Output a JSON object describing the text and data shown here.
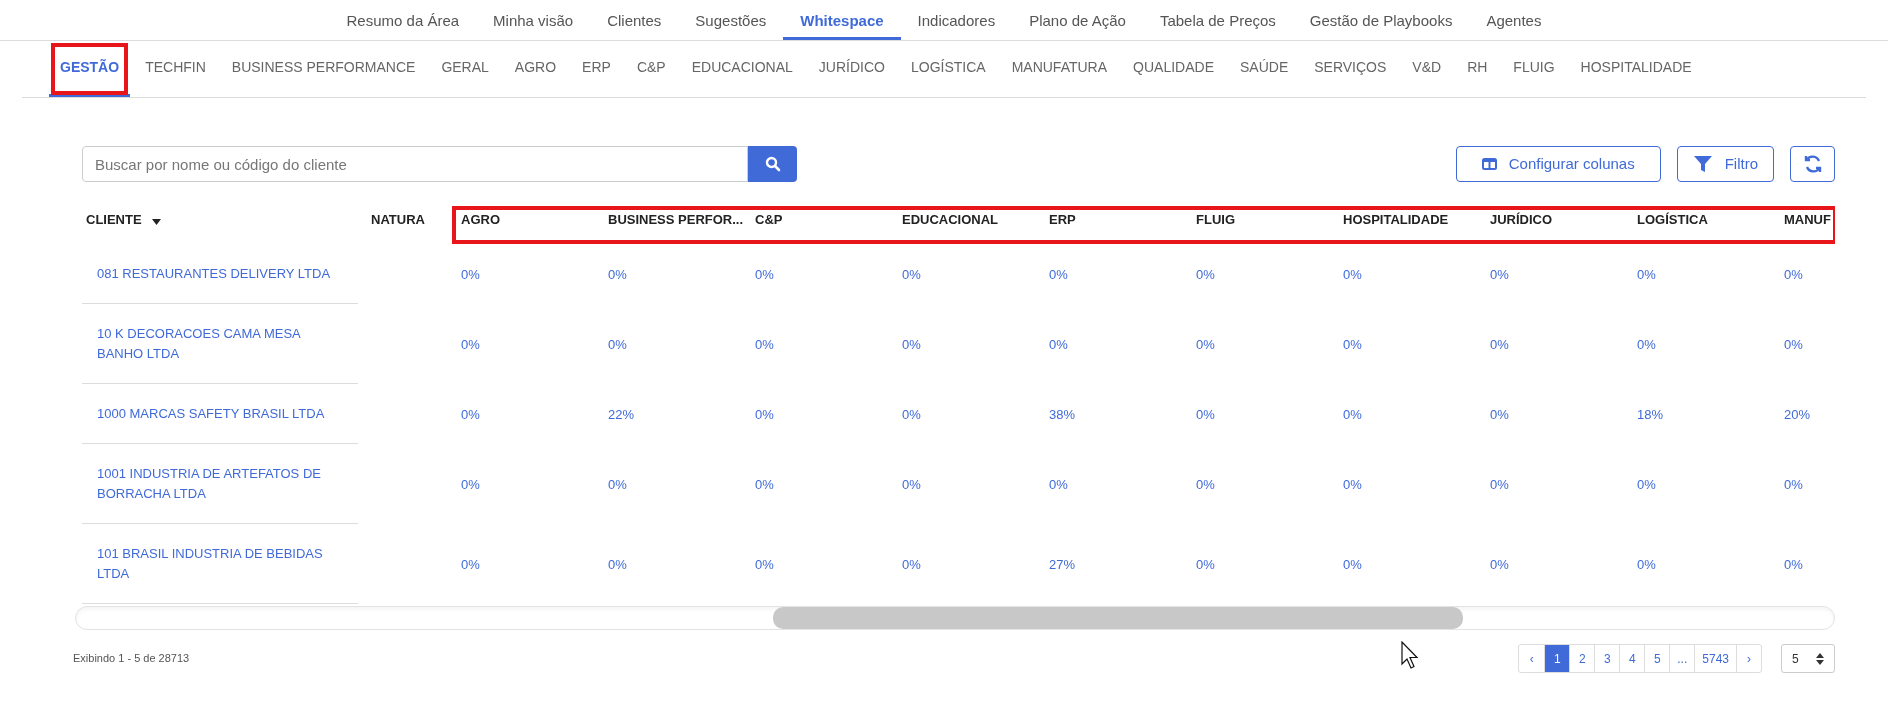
{
  "top_nav": [
    {
      "label": "Resumo da Área",
      "selected": false
    },
    {
      "label": "Minha visão",
      "selected": false
    },
    {
      "label": "Clientes",
      "selected": false
    },
    {
      "label": "Sugestões",
      "selected": false
    },
    {
      "label": "Whitespace",
      "selected": true
    },
    {
      "label": "Indicadores",
      "selected": false
    },
    {
      "label": "Plano de Ação",
      "selected": false
    },
    {
      "label": "Tabela de Preços",
      "selected": false
    },
    {
      "label": "Gestão de Playbooks",
      "selected": false
    },
    {
      "label": "Agentes",
      "selected": false
    }
  ],
  "tabs": [
    {
      "label": "GESTÃO",
      "selected": true,
      "annotated": true
    },
    {
      "label": "TECHFIN",
      "selected": false,
      "annotated": false
    },
    {
      "label": "BUSINESS PERFORMANCE",
      "selected": false,
      "annotated": false
    },
    {
      "label": "GERAL",
      "selected": false,
      "annotated": false
    },
    {
      "label": "AGRO",
      "selected": false,
      "annotated": false
    },
    {
      "label": "ERP",
      "selected": false,
      "annotated": false
    },
    {
      "label": "C&P",
      "selected": false,
      "annotated": false
    },
    {
      "label": "EDUCACIONAL",
      "selected": false,
      "annotated": false
    },
    {
      "label": "JURÍDICO",
      "selected": false,
      "annotated": false
    },
    {
      "label": "LOGÍSTICA",
      "selected": false,
      "annotated": false
    },
    {
      "label": "MANUFATURA",
      "selected": false,
      "annotated": false
    },
    {
      "label": "QUALIDADE",
      "selected": false,
      "annotated": false
    },
    {
      "label": "SAÚDE",
      "selected": false,
      "annotated": false
    },
    {
      "label": "SERVIÇOS",
      "selected": false,
      "annotated": false
    },
    {
      "label": "V&D",
      "selected": false,
      "annotated": false
    },
    {
      "label": "RH",
      "selected": false,
      "annotated": false
    },
    {
      "label": "FLUIG",
      "selected": false,
      "annotated": false
    },
    {
      "label": "HOSPITALIDADE",
      "selected": false,
      "annotated": false
    }
  ],
  "search": {
    "placeholder": "Buscar por nome ou código do cliente"
  },
  "toolbar": {
    "configure_label": "Configurar colunas",
    "filter_label": "Filtro"
  },
  "table": {
    "client_column": "CLIENTE",
    "second_column": "NATURA",
    "headers_annotated": true,
    "columns": [
      "AGRO",
      "BUSINESS PERFOR...",
      "C&P",
      "EDUCACIONAL",
      "ERP",
      "FLUIG",
      "HOSPITALIDADE",
      "JURÍDICO",
      "LOGÍSTICA",
      "MANUF"
    ],
    "rows": [
      {
        "client": "081 RESTAURANTES DELIVERY LTDA",
        "values": [
          "0%",
          "0%",
          "0%",
          "0%",
          "0%",
          "0%",
          "0%",
          "0%",
          "0%",
          "0%"
        ]
      },
      {
        "client": "10 K DECORACOES CAMA MESA BANHO LTDA",
        "values": [
          "0%",
          "0%",
          "0%",
          "0%",
          "0%",
          "0%",
          "0%",
          "0%",
          "0%",
          "0%"
        ]
      },
      {
        "client": "1000 MARCAS SAFETY BRASIL LTDA",
        "values": [
          "0%",
          "22%",
          "0%",
          "0%",
          "38%",
          "0%",
          "0%",
          "0%",
          "18%",
          "20%"
        ]
      },
      {
        "client": "1001 INDUSTRIA DE ARTEFATOS DE BORRACHA LTDA",
        "values": [
          "0%",
          "0%",
          "0%",
          "0%",
          "0%",
          "0%",
          "0%",
          "0%",
          "0%",
          "0%"
        ]
      },
      {
        "client": "101 BRASIL INDUSTRIA DE BEBIDAS LTDA",
        "values": [
          "0%",
          "0%",
          "0%",
          "0%",
          "27%",
          "0%",
          "0%",
          "0%",
          "0%",
          "0%"
        ]
      }
    ]
  },
  "footer": {
    "summary": "Exibindo 1 - 5 de 28713",
    "pages": [
      {
        "label": "‹",
        "selected": false
      },
      {
        "label": "1",
        "selected": true
      },
      {
        "label": "2",
        "selected": false
      },
      {
        "label": "3",
        "selected": false
      },
      {
        "label": "4",
        "selected": false
      },
      {
        "label": "5",
        "selected": false
      },
      {
        "label": "...",
        "selected": false
      },
      {
        "label": "5743",
        "selected": false
      },
      {
        "label": "›",
        "selected": false
      }
    ],
    "page_size": "5"
  }
}
